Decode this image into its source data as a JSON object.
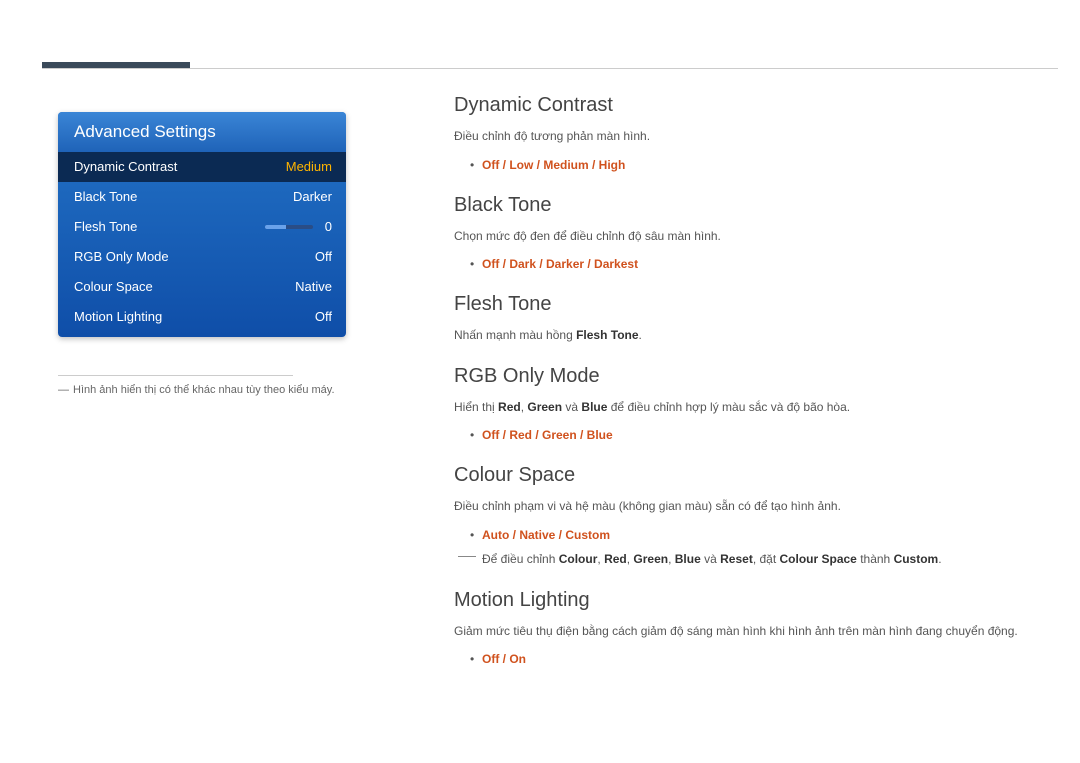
{
  "menu": {
    "title": "Advanced Settings",
    "rows": [
      {
        "label": "Dynamic Contrast",
        "value": "Medium"
      },
      {
        "label": "Black Tone",
        "value": "Darker"
      },
      {
        "label": "Flesh Tone",
        "value": "0"
      },
      {
        "label": "RGB Only Mode",
        "value": "Off"
      },
      {
        "label": "Colour Space",
        "value": "Native"
      },
      {
        "label": "Motion Lighting",
        "value": "Off"
      }
    ]
  },
  "caption": {
    "dash": "―",
    "text": "Hình ảnh hiển thị có thể khác nhau tùy theo kiểu máy."
  },
  "sections": {
    "dynamic_contrast": {
      "title": "Dynamic Contrast",
      "desc": "Điều chỉnh độ tương phản màn hình.",
      "opts": "Off / Low / Medium / High"
    },
    "black_tone": {
      "title": "Black Tone",
      "desc": "Chọn mức độ đen để điều chỉnh độ sâu màn hình.",
      "opts": "Off / Dark / Darker / Darkest"
    },
    "flesh_tone": {
      "title": "Flesh Tone",
      "desc_pre": "Nhấn mạnh màu hồng ",
      "desc_kw": "Flesh Tone",
      "desc_post": "."
    },
    "rgb_only": {
      "title": "RGB Only Mode",
      "desc_pre": "Hiển thị ",
      "kw_red": "Red",
      "sep1": ", ",
      "kw_green": "Green",
      "mid": " và ",
      "kw_blue": "Blue",
      "desc_post": " để điều chỉnh hợp lý màu sắc và độ bão hòa.",
      "opts": "Off / Red / Green / Blue"
    },
    "colour_space": {
      "title": "Colour Space",
      "desc": "Điều chỉnh phạm vi và hệ màu (không gian màu) sẵn có để tạo hình ảnh.",
      "opts": "Auto / Native / Custom",
      "note_pre": "Để điều chỉnh ",
      "note_colour": "Colour",
      "note_s1": ", ",
      "note_red": "Red",
      "note_s2": ", ",
      "note_green": "Green",
      "note_s3": ", ",
      "note_blue": "Blue",
      "note_and": " và ",
      "note_reset": "Reset",
      "note_set": ", đặt ",
      "note_cs": "Colour Space",
      "note_to": " thành ",
      "note_custom": "Custom",
      "note_end": "."
    },
    "motion_lighting": {
      "title": "Motion Lighting",
      "desc": "Giảm mức tiêu thụ điện bằng cách giảm độ sáng màn hình khi hình ảnh trên màn hình đang chuyển động.",
      "opts": "Off / On"
    }
  }
}
